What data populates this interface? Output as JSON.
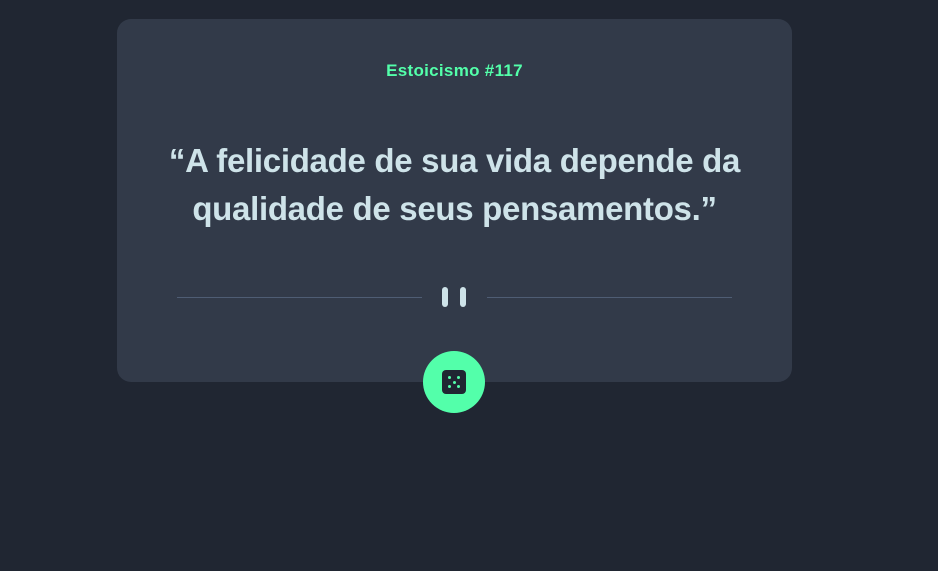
{
  "card": {
    "advice_id": "Estoicismo #117",
    "advice_text": "“A felicidade de sua vida depende da qualidade de seus pensamentos.”"
  },
  "icons": {
    "divider": "pause-icon",
    "button": "dice-icon"
  },
  "colors": {
    "background": "#202632",
    "card": "#323a49",
    "accent": "#53ffaa",
    "text": "#cee3e9",
    "divider": "#4f5d74"
  }
}
